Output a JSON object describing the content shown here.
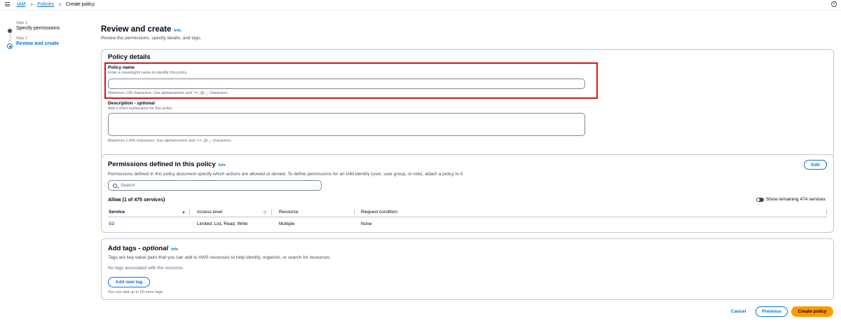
{
  "breadcrumb": {
    "root": "IAM",
    "section": "Policies",
    "current": "Create policy",
    "separator": ">"
  },
  "steps": [
    {
      "number": "Step 1",
      "title": "Specify permissions",
      "active": false
    },
    {
      "number": "Step 2",
      "title": "Review and create",
      "active": true
    }
  ],
  "header": {
    "title": "Review and create",
    "info": "Info",
    "subtitle": "Review the permissions, specify details, and tags."
  },
  "policy_details": {
    "title": "Policy details",
    "name_label": "Policy name",
    "name_desc": "Enter a meaningful name to identify this policy.",
    "name_value": "",
    "name_hint": "Maximum 128 characters. Use alphanumeric and '+=,.@-_' characters.",
    "desc_label": "Description",
    "desc_optional": "optional",
    "desc_desc": "Add a short explanation for this policy.",
    "desc_value": "",
    "desc_hint": "Maximum 1,000 characters. Use alphanumeric and '+=,.@-_' characters."
  },
  "permissions": {
    "title": "Permissions defined in this policy",
    "info": "Info",
    "description": "Permissions defined in this policy document specify which actions are allowed or denied. To define permissions for an IAM identity (user, user group, or role), attach a policy to it",
    "edit_label": "Edit",
    "search_placeholder": "Search",
    "allow_label": "Allow (1 of 475 services)",
    "toggle_label": "Show remaining 474 services",
    "columns": [
      "Service",
      "Access level",
      "Resource",
      "Request condition"
    ],
    "rows": [
      {
        "service": "S3",
        "access": "Limited: List, Read, Write",
        "resource": "Multiple",
        "condition": "None"
      }
    ]
  },
  "tags": {
    "title": "Add tags",
    "optional": "optional",
    "info": "Info",
    "description": "Tags are key-value pairs that you can add to AWS resources to help identify, organize, or search for resources.",
    "empty": "No tags associated with the resource.",
    "add_label": "Add new tag",
    "hint": "You can add up to 50 more tags."
  },
  "footer": {
    "cancel": "Cancel",
    "previous": "Previous",
    "create": "Create policy"
  },
  "colors": {
    "accent": "#0972d3",
    "primary": "#ff9900",
    "highlight": "#d91515"
  }
}
